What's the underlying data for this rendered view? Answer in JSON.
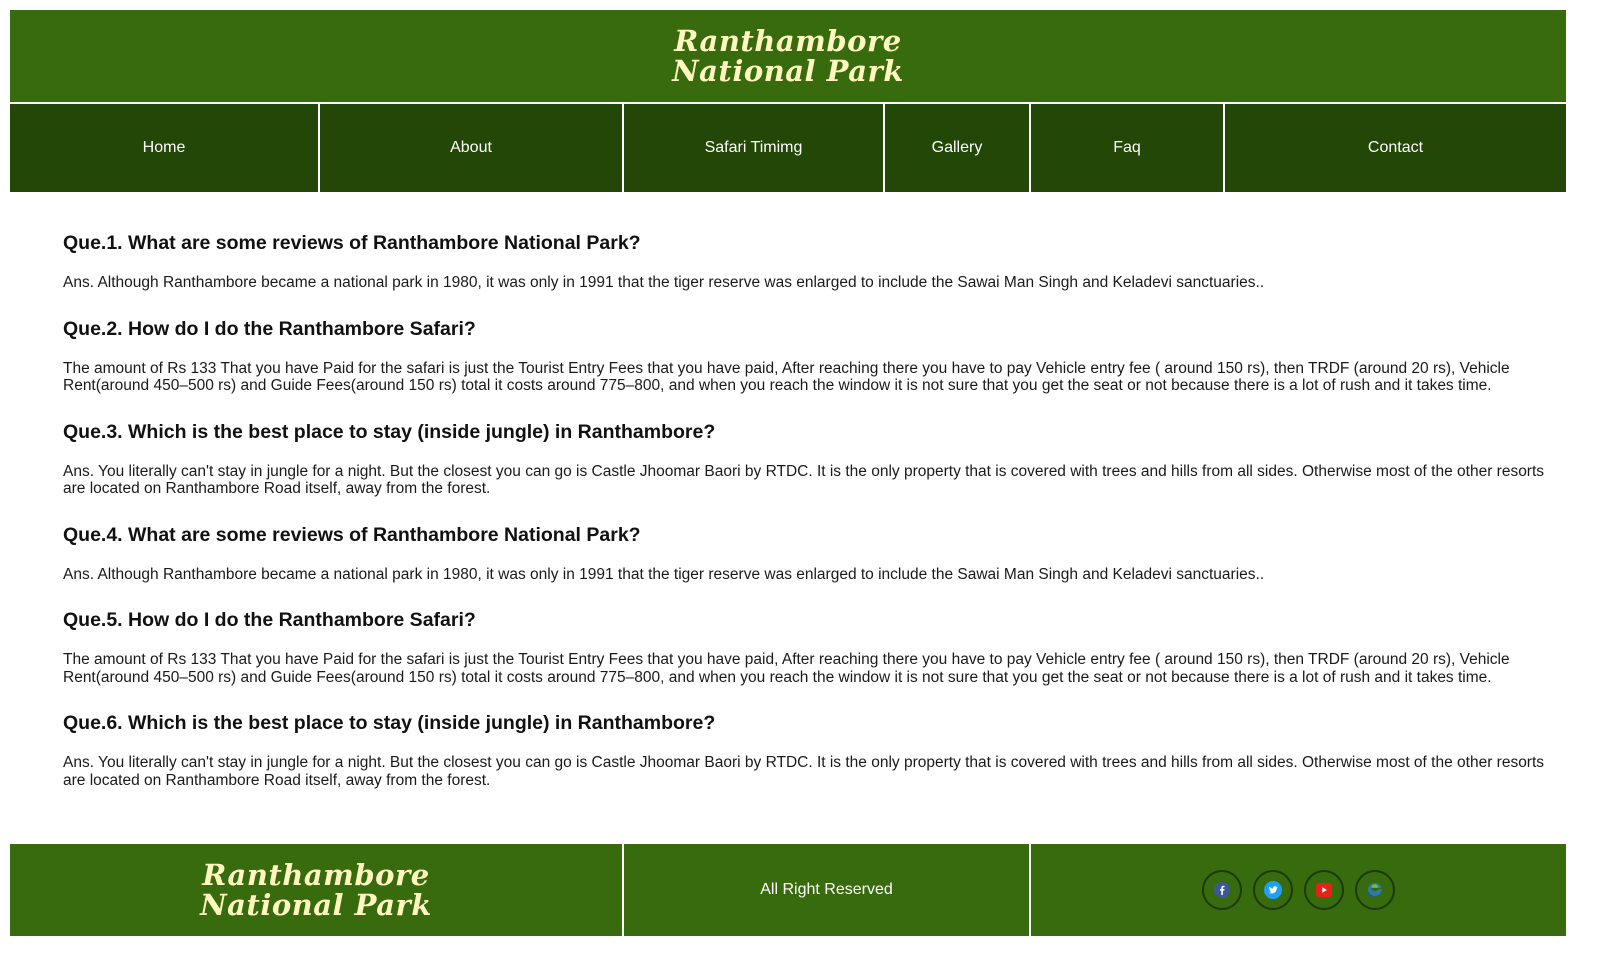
{
  "header": {
    "logo_line1": "Ranthambore",
    "logo_line2": "National Park"
  },
  "nav": {
    "items": [
      {
        "label": "Home"
      },
      {
        "label": "About"
      },
      {
        "label": "Safari Timimg"
      },
      {
        "label": "Gallery"
      },
      {
        "label": "Faq"
      },
      {
        "label": "Contact"
      }
    ]
  },
  "faq": [
    {
      "q": "Que.1. What are some reviews of Ranthambore National Park?",
      "a": "Ans. Although Ranthambore became a national park in 1980, it was only in 1991 that the tiger reserve was enlarged to include the Sawai Man Singh and Keladevi sanctuaries.."
    },
    {
      "q": "Que.2. How do I do the Ranthambore Safari?",
      "a": "The amount of Rs 133 That you have Paid for the safari is just the Tourist Entry Fees that you have paid, After reaching there you have to pay Vehicle entry fee ( around 150 rs), then TRDF (around 20 rs), Vehicle Rent(around 450–500 rs) and Guide Fees(around 150 rs) total it costs around 775–800, and when you reach the window it is not sure that you get the seat or not because there is a lot of rush and it takes time."
    },
    {
      "q": "Que.3. Which is the best place to stay (inside jungle) in Ranthambore?",
      "a": "Ans. You literally can't stay in jungle for a night. But the closest you can go is Castle Jhoomar Baori by RTDC. It is the only property that is covered with trees and hills from all sides. Otherwise most of the other resorts are located on Ranthambore Road itself, away from the forest."
    },
    {
      "q": "Que.4. What are some reviews of Ranthambore National Park?",
      "a": "Ans. Although Ranthambore became a national park in 1980, it was only in 1991 that the tiger reserve was enlarged to include the Sawai Man Singh and Keladevi sanctuaries.."
    },
    {
      "q": "Que.5. How do I do the Ranthambore Safari?",
      "a": "The amount of Rs 133 That you have Paid for the safari is just the Tourist Entry Fees that you have paid, After reaching there you have to pay Vehicle entry fee ( around 150 rs), then TRDF (around 20 rs), Vehicle Rent(around 450–500 rs) and Guide Fees(around 150 rs) total it costs around 775–800, and when you reach the window it is not sure that you get the seat or not because there is a lot of rush and it takes time."
    },
    {
      "q": "Que.6. Which is the best place to stay (inside jungle) in Ranthambore?",
      "a": "Ans. You literally can't stay in jungle for a night. But the closest you can go is Castle Jhoomar Baori by RTDC. It is the only property that is covered with trees and hills from all sides. Otherwise most of the other resorts are located on Ranthambore Road itself, away from the forest."
    }
  ],
  "footer": {
    "logo_line1": "Ranthambore",
    "logo_line2": "National Park",
    "rights": "All Right Reserved",
    "social": [
      {
        "icon": "facebook-icon",
        "color": "#3b5998"
      },
      {
        "icon": "twitter-icon",
        "color": "#1da1f2"
      },
      {
        "icon": "youtube-icon",
        "color": "#e62117"
      },
      {
        "icon": "edge-icon",
        "color": "#2a7ab5"
      }
    ]
  },
  "colors": {
    "header_green": "#386b0d",
    "nav_green": "#224706",
    "logo_cream": "#fff7bf"
  }
}
